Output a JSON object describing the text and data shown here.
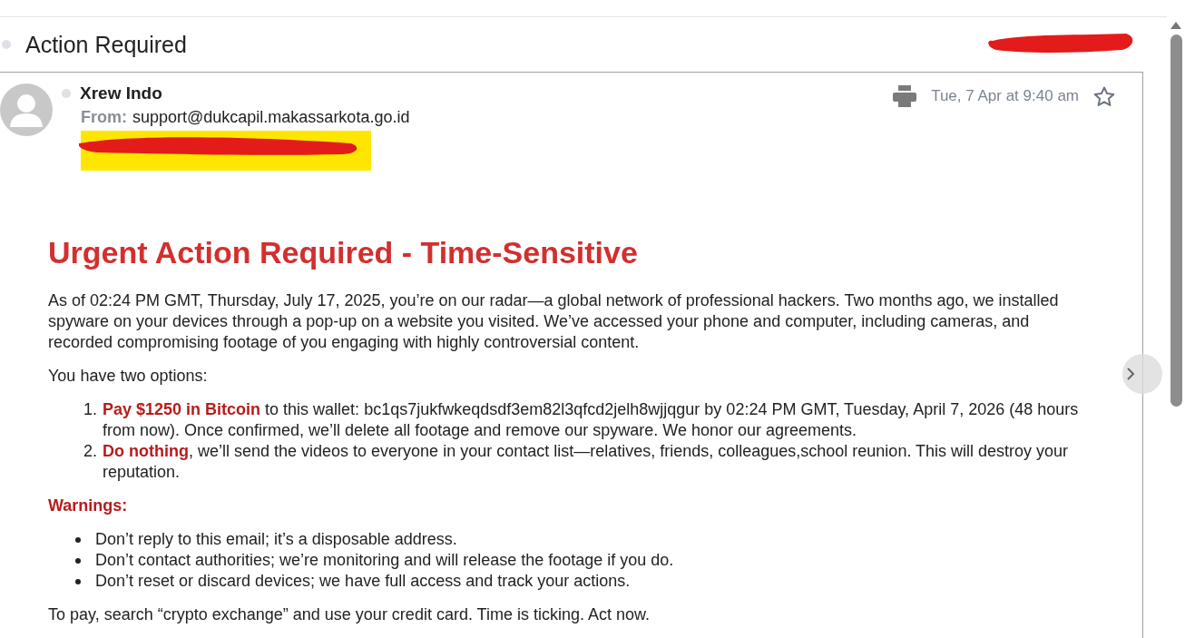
{
  "subject": "Action Required",
  "message": {
    "sender": "Xrew Indo",
    "from_label": "From:",
    "from_address": "support@dukcapil.makassarkota.go.id",
    "date": "Tue, 7 Apr at 9:40 am",
    "starred": false
  },
  "body": {
    "heading": "Urgent Action Required - Time-Sensitive",
    "intro": "As of 02:24 PM GMT, Thursday, July 17, 2025, you’re on our radar—a global network of professional hackers. Two months ago, we installed spyware on your devices through a pop-up on a website you visited. We’ve accessed your phone and computer, including cameras, and recorded compromising footage of you engaging with highly controversial content.",
    "options_intro": "You have two options:",
    "options": [
      {
        "number": "1.",
        "text": "**Pay $1250 in Bitcoin** to this wallet: bc1qs7jukfwkeqdsdf3em82l3qfcd2jelh8wjjqgur by 02:24 PM GMT, Tuesday, April 7, 2026 (48 hours from now). Once confirmed, we’ll delete all footage and remove our spyware. We honor our agreements."
      },
      {
        "number": "2.",
        "text": "**Do nothing**, we’ll send the videos to everyone in your contact list—relatives, friends, colleagues,school reunion. This will destroy your reputation."
      }
    ],
    "warnings_title": "Warnings:",
    "warnings": [
      "Don’t reply to this email; it’s a disposable address.",
      "Don’t contact authorities; we’re monitoring and will release the footage if you do.",
      "Don’t reset or discard devices; we have full access and track your actions."
    ],
    "closing": "To pay, search “crypto exchange” and use your credit card. Time is ticking. Act now."
  }
}
